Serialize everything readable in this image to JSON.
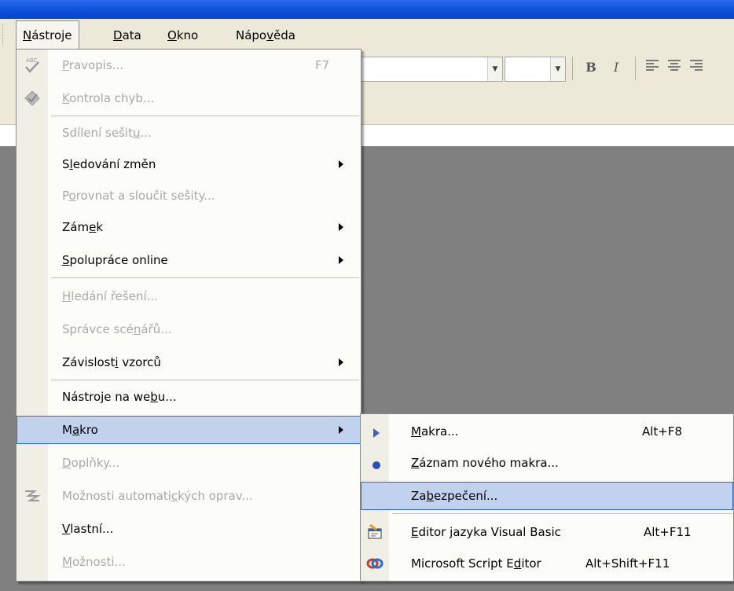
{
  "menubar": {
    "items": [
      {
        "pre": "",
        "u": "N",
        "post": "ástroje"
      },
      {
        "pre": "",
        "u": "D",
        "post": "ata"
      },
      {
        "pre": "",
        "u": "O",
        "post": "kno"
      },
      {
        "pre": "Nápo",
        "u": "v",
        "post": "ěda"
      }
    ]
  },
  "toolbar": {
    "bold": "B",
    "italic": "I"
  },
  "tools_menu": {
    "items": [
      {
        "pre": "",
        "u": "P",
        "post": "ravopis...",
        "shortcut": "F7"
      },
      {
        "pre": "",
        "u": "K",
        "post": "ontrola chyb..."
      },
      {
        "pre": "Sdílení sešit",
        "u": "u",
        "post": "..."
      },
      {
        "pre": "S",
        "u": "l",
        "post": "edování změn"
      },
      {
        "pre": "P",
        "u": "o",
        "post": "rovnat a sloučit sešity..."
      },
      {
        "pre": "Zám",
        "u": "e",
        "post": "k"
      },
      {
        "pre": "",
        "u": "S",
        "post": "polupráce online"
      },
      {
        "pre": "",
        "u": "H",
        "post": "ledání řešení..."
      },
      {
        "pre": "Správce scé",
        "u": "n",
        "post": "ářů..."
      },
      {
        "pre": "Závislost",
        "u": "i",
        "post": " vzorců"
      },
      {
        "pre": "Nástroje na we",
        "u": "b",
        "post": "u..."
      },
      {
        "pre": "M",
        "u": "a",
        "post": "kro"
      },
      {
        "pre": "",
        "u": "D",
        "post": "oplňky..."
      },
      {
        "pre": "Možnosti automati",
        "u": "c",
        "post": "kých oprav..."
      },
      {
        "pre": "",
        "u": "V",
        "post": "lastní..."
      },
      {
        "pre": "",
        "u": "M",
        "post": "ožnosti..."
      }
    ]
  },
  "macro_menu": {
    "items": [
      {
        "pre": "",
        "u": "M",
        "post": "akra...",
        "shortcut": "Alt+F8"
      },
      {
        "pre": "",
        "u": "Z",
        "post": "áznam nového makra..."
      },
      {
        "pre": "Za",
        "u": "b",
        "post": "ezpečení..."
      },
      {
        "pre": "",
        "u": "E",
        "post": "ditor jazyka Visual Basic",
        "shortcut": "Alt+F11"
      },
      {
        "pre": "Microsoft Script E",
        "u": "d",
        "post": "itor",
        "shortcut": "Alt+Shift+F11"
      }
    ]
  },
  "colors": {
    "title_bar": "#0a4fd8",
    "menu_face": "#ece9d8",
    "highlight_fill": "#c1d2ee",
    "highlight_border": "#316ac5",
    "disabled_text": "#a9a9a9",
    "workspace": "#808080"
  }
}
